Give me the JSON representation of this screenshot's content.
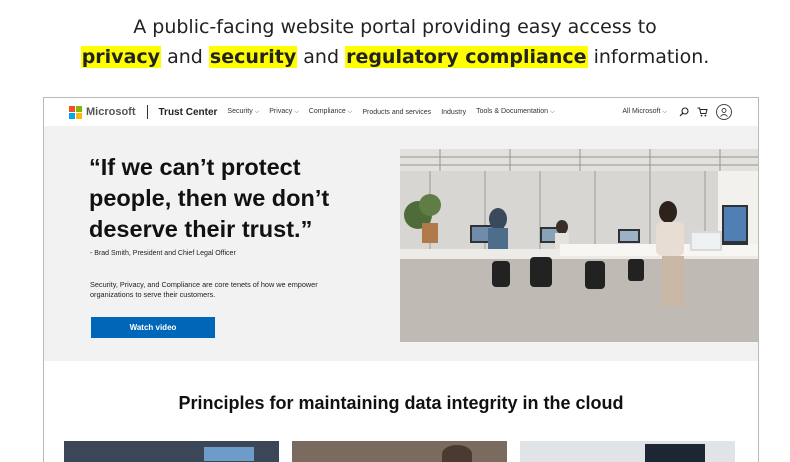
{
  "caption": {
    "line1": "A public-facing website portal providing  easy access to",
    "kw_privacy": "privacy",
    "and1": "and",
    "kw_security": "security",
    "and2": "and",
    "kw_compliance": "regulatory compliance",
    "tail": "information."
  },
  "header": {
    "logo_text": "Microsoft",
    "logo_colors": [
      "#f25022",
      "#7fba00",
      "#00a4ef",
      "#ffb900"
    ],
    "brand": "Trust Center",
    "menu": [
      {
        "label": "Security",
        "dropdown": true
      },
      {
        "label": "Privacy",
        "dropdown": true
      },
      {
        "label": "Compliance",
        "dropdown": true
      },
      {
        "label": "Products and services",
        "dropdown": false
      },
      {
        "label": "Industry",
        "dropdown": false
      },
      {
        "label": "Tools & Documentation",
        "dropdown": true
      }
    ],
    "all_microsoft": "All Microsoft",
    "icons": [
      "search-icon",
      "cart-icon",
      "account-icon"
    ]
  },
  "hero": {
    "quote": "“If we can’t protect people, then we don’t deserve their trust.”",
    "attribution": "- Brad Smith, President and Chief Legal Officer",
    "description": "Security, Privacy, and Compliance are core tenets of how we empower organizations to serve their customers.",
    "cta_label": "Watch video",
    "cta_color": "#0067b8",
    "image": "office-workspace-photo"
  },
  "section": {
    "title": "Principles for maintaining data integrity in the cloud"
  },
  "colors": {
    "highlight": "#ffff00",
    "hero_bg": "#f2f2f2"
  }
}
